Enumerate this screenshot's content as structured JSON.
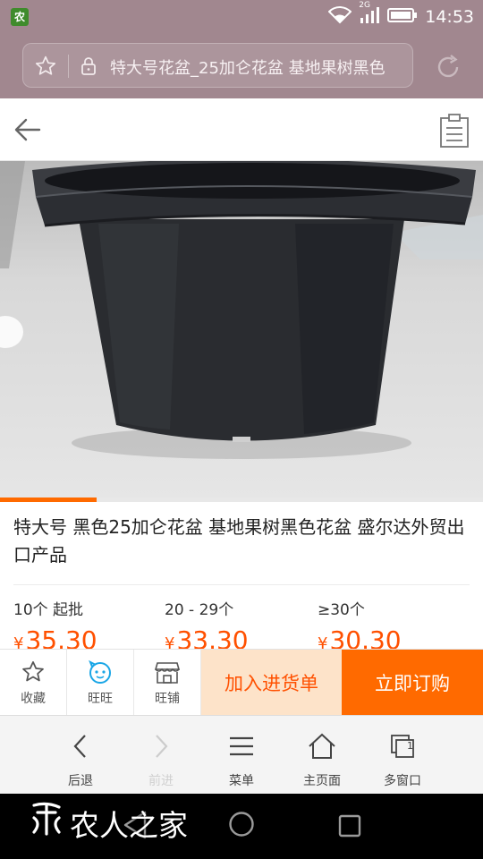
{
  "status_bar": {
    "app_icon_label": "农",
    "network": "2G",
    "time": "14:53"
  },
  "url_bar": {
    "page_title": "特大号花盆_25加仑花盆 基地果树黑色"
  },
  "product": {
    "title": "特大号 黑色25加仑花盆 基地果树黑色花盆 盛尔达外贸出口产品",
    "image_progress": 0.2,
    "price_tiers": [
      {
        "label": "10个 起批",
        "currency": "¥",
        "price": "35.30"
      },
      {
        "label": "20 - 29个",
        "currency": "¥",
        "price": "33.30"
      },
      {
        "label": "≥30个",
        "currency": "¥",
        "price": "30.30"
      }
    ]
  },
  "action_bar": {
    "favorite_label": "收藏",
    "wangwang_label": "旺旺",
    "shop_label": "旺铺",
    "add_cart_label": "加入进货单",
    "buy_now_label": "立即订购",
    "accent_color": "#ff6a00"
  },
  "browser_toolbar": {
    "back_label": "后退",
    "forward_label": "前进",
    "menu_label": "菜单",
    "home_label": "主页面",
    "windows_label": "多窗口",
    "windows_count": "1"
  },
  "watermark": {
    "text": "农人之家"
  }
}
